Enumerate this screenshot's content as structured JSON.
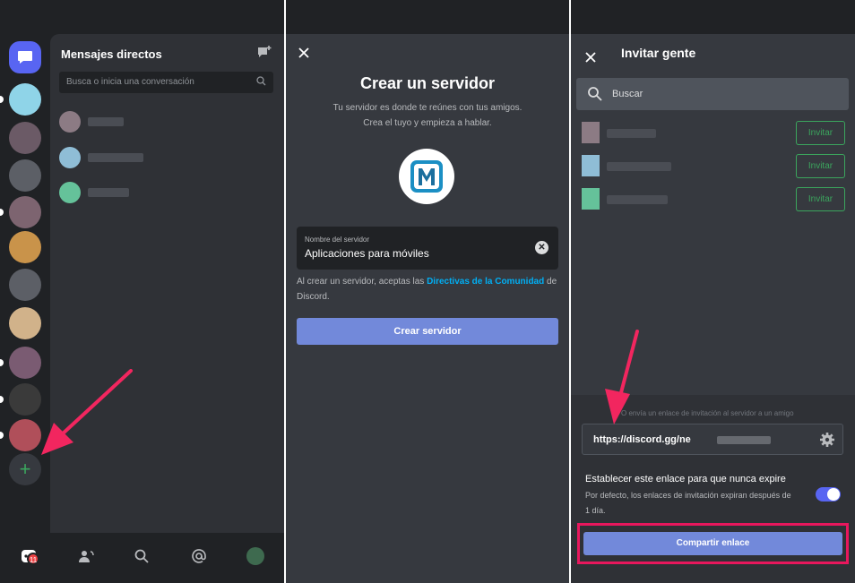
{
  "panel1": {
    "dm_title": "Mensajes directos",
    "search_placeholder": "Busca o inicia una conversación",
    "add_server_symbol": "+",
    "badge_count": "11",
    "guild_colors": [
      "#8fd4e8",
      "#6b5a66",
      "#5c5f66",
      "#7d6470",
      "#c9934a",
      "#5c5f66",
      "#d1b28a",
      "#7a5b72",
      "#3a3a3a",
      "#b04f5a"
    ],
    "dm_avatar_colors": [
      "#8c7b84",
      "#8fbdd6",
      "#65c29a"
    ],
    "icons": [
      "chat-bubble-icon",
      "new-dm-icon",
      "search-icon",
      "friends-icon",
      "mention-icon",
      "profile-avatar-icon"
    ],
    "arrow_color": "#f2265f"
  },
  "panel2": {
    "title": "Crear un servidor",
    "subtitle_line1": "Tu servidor es donde te reúnes con tus amigos.",
    "subtitle_line2": "Crea el tuyo y empieza a hablar.",
    "logo_letter": "M",
    "field_label": "Nombre del servidor",
    "field_value": "Aplicaciones para móviles",
    "terms_prefix": "Al crear un servidor, aceptas las ",
    "terms_link": "Directivas de la Comunidad",
    "terms_suffix": " de Discord.",
    "create_button": "Crear servidor"
  },
  "panel3": {
    "title": "Invitar gente",
    "search_placeholder": "Buscar",
    "invite_label": "Invitar",
    "share_hint": "O envía un enlace de invitación al servidor a un amigo",
    "url_prefix": "https://discord.gg/ne",
    "expire_title": "Establecer este enlace para que nunca expire",
    "expire_desc": "Por defecto, los enlaces de invitación expiran después de 1 día.",
    "share_button": "Compartir enlace",
    "highlight_color": "#e8175d"
  }
}
